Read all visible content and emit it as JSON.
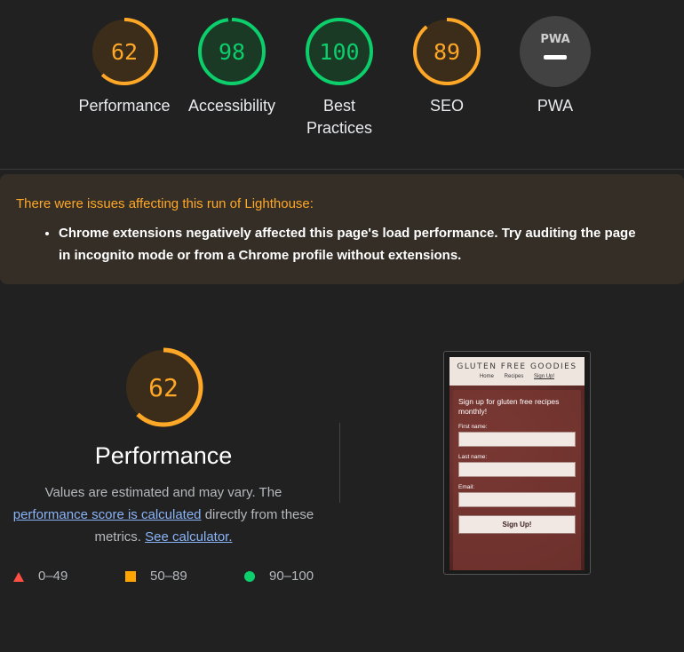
{
  "scores": [
    {
      "value": "62",
      "label": "Performance",
      "fraction": 0.62,
      "color": "#ffa726",
      "bg": "#3b2d1a"
    },
    {
      "value": "98",
      "label": "Accessibility",
      "fraction": 0.98,
      "color": "#0cce6b",
      "bg": "#1b3a26"
    },
    {
      "value": "100",
      "label": "Best Practices",
      "fraction": 1.0,
      "color": "#0cce6b",
      "bg": "#1b3a26"
    },
    {
      "value": "89",
      "label": "SEO",
      "fraction": 0.89,
      "color": "#ffa726",
      "bg": "#3b2d1a"
    },
    {
      "value": "",
      "label": "PWA",
      "badge": "PWA"
    }
  ],
  "warning": {
    "title": "There were issues affecting this run of Lighthouse:",
    "items": [
      "Chrome extensions negatively affected this page's load performance. Try auditing the page in incognito mode or from a Chrome profile without extensions."
    ]
  },
  "performance": {
    "score": "62",
    "fraction": 0.62,
    "title": "Performance",
    "desc_part1": "Values are estimated and may vary. The",
    "link1": "performance score is calculated",
    "desc_part2": "directly from these metrics.",
    "link2": "See calculator."
  },
  "legend": [
    "0–49",
    "50–89",
    "90–100"
  ],
  "screenshot": {
    "brand": "GLUTEN FREE GOODIES",
    "nav": [
      "Home",
      "Recipes",
      "Sign Up!"
    ],
    "form_title": "Sign up for gluten free recipes monthly!",
    "labels": [
      "First name:",
      "Last name:",
      "Email:"
    ],
    "button": "Sign Up!"
  }
}
